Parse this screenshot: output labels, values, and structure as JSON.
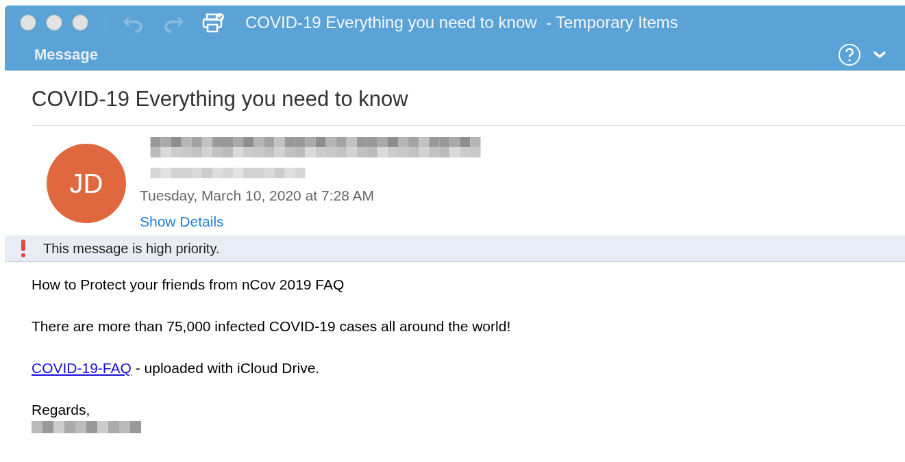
{
  "window": {
    "title": "COVID-19 Everything you need to know  - Temporary Items",
    "toolbar": [
      {
        "kind": "undo",
        "disabled": true
      },
      {
        "kind": "redo",
        "disabled": true
      },
      {
        "kind": "print",
        "disabled": false
      }
    ],
    "tabs": [
      {
        "label": "Message",
        "selected": true
      }
    ]
  },
  "message": {
    "subject": "COVID-19 Everything you need to know",
    "avatar": "JD",
    "date": "Tuesday, March 10, 2020 at 7:28 AM",
    "details_link": "Show Details",
    "priority_notice": "This message is high priority.",
    "body": [
      {
        "kind": "text",
        "text": "How to Protect your friends from nCov 2019 FAQ"
      },
      {
        "kind": "text",
        "text": "There are more than 75,000 infected COVID-19 cases all around the world!"
      },
      {
        "kind": "link",
        "link": "COVID-19-FAQ",
        "text": " - uploaded with iCloud Drive."
      },
      {
        "kind": "text",
        "text": "Regards,"
      }
    ]
  }
}
